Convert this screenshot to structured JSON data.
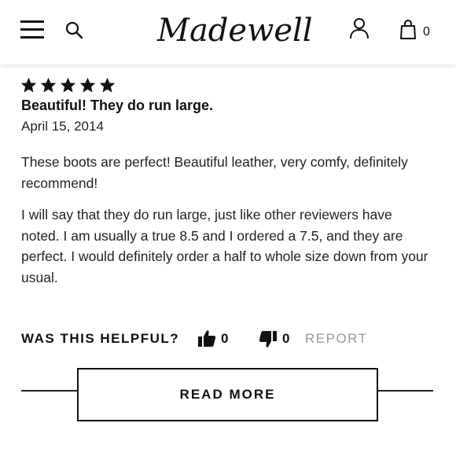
{
  "header": {
    "logo_text": "Madewell",
    "bag_count": "0",
    "icons": {
      "menu": "hamburger-menu-icon",
      "search": "search-icon",
      "account": "account-icon",
      "bag": "shopping-bag-icon"
    }
  },
  "review": {
    "rating": 5,
    "rating_max": 5,
    "title": "Beautiful! They do run large.",
    "date": "April 15, 2014",
    "paragraphs": [
      "These boots are perfect! Beautiful leather, very comfy, definitely recommend!",
      "I will say that they do run large, just like other reviewers have noted. I am usually a true 8.5 and I ordered a 7.5, and they are perfect. I would definitely order a half to whole size down from your usual."
    ],
    "helpful": {
      "label": "WAS THIS HELPFUL?",
      "up_count": "0",
      "down_count": "0",
      "report_label": "REPORT"
    }
  },
  "read_more_label": "READ MORE",
  "colors": {
    "text": "#111111",
    "muted": "#9a9a9a",
    "background": "#ffffff"
  }
}
